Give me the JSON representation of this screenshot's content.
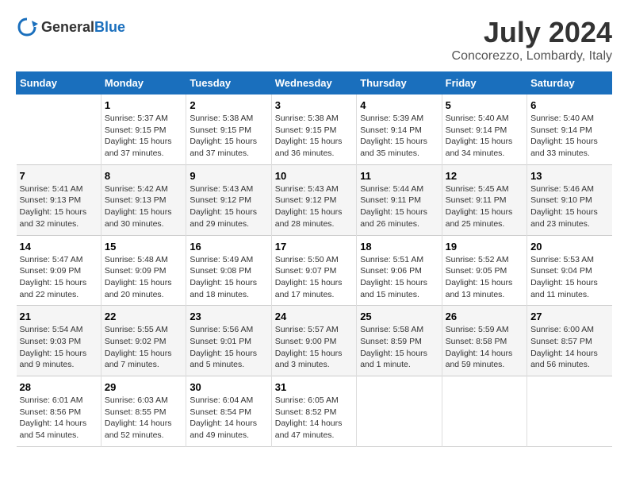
{
  "header": {
    "logo_general": "General",
    "logo_blue": "Blue",
    "title": "July 2024",
    "subtitle": "Concorezzo, Lombardy, Italy"
  },
  "calendar": {
    "days_of_week": [
      "Sunday",
      "Monday",
      "Tuesday",
      "Wednesday",
      "Thursday",
      "Friday",
      "Saturday"
    ],
    "weeks": [
      [
        {
          "day": "",
          "info": ""
        },
        {
          "day": "1",
          "info": "Sunrise: 5:37 AM\nSunset: 9:15 PM\nDaylight: 15 hours\nand 37 minutes."
        },
        {
          "day": "2",
          "info": "Sunrise: 5:38 AM\nSunset: 9:15 PM\nDaylight: 15 hours\nand 37 minutes."
        },
        {
          "day": "3",
          "info": "Sunrise: 5:38 AM\nSunset: 9:15 PM\nDaylight: 15 hours\nand 36 minutes."
        },
        {
          "day": "4",
          "info": "Sunrise: 5:39 AM\nSunset: 9:14 PM\nDaylight: 15 hours\nand 35 minutes."
        },
        {
          "day": "5",
          "info": "Sunrise: 5:40 AM\nSunset: 9:14 PM\nDaylight: 15 hours\nand 34 minutes."
        },
        {
          "day": "6",
          "info": "Sunrise: 5:40 AM\nSunset: 9:14 PM\nDaylight: 15 hours\nand 33 minutes."
        }
      ],
      [
        {
          "day": "7",
          "info": "Sunrise: 5:41 AM\nSunset: 9:13 PM\nDaylight: 15 hours\nand 32 minutes."
        },
        {
          "day": "8",
          "info": "Sunrise: 5:42 AM\nSunset: 9:13 PM\nDaylight: 15 hours\nand 30 minutes."
        },
        {
          "day": "9",
          "info": "Sunrise: 5:43 AM\nSunset: 9:12 PM\nDaylight: 15 hours\nand 29 minutes."
        },
        {
          "day": "10",
          "info": "Sunrise: 5:43 AM\nSunset: 9:12 PM\nDaylight: 15 hours\nand 28 minutes."
        },
        {
          "day": "11",
          "info": "Sunrise: 5:44 AM\nSunset: 9:11 PM\nDaylight: 15 hours\nand 26 minutes."
        },
        {
          "day": "12",
          "info": "Sunrise: 5:45 AM\nSunset: 9:11 PM\nDaylight: 15 hours\nand 25 minutes."
        },
        {
          "day": "13",
          "info": "Sunrise: 5:46 AM\nSunset: 9:10 PM\nDaylight: 15 hours\nand 23 minutes."
        }
      ],
      [
        {
          "day": "14",
          "info": "Sunrise: 5:47 AM\nSunset: 9:09 PM\nDaylight: 15 hours\nand 22 minutes."
        },
        {
          "day": "15",
          "info": "Sunrise: 5:48 AM\nSunset: 9:09 PM\nDaylight: 15 hours\nand 20 minutes."
        },
        {
          "day": "16",
          "info": "Sunrise: 5:49 AM\nSunset: 9:08 PM\nDaylight: 15 hours\nand 18 minutes."
        },
        {
          "day": "17",
          "info": "Sunrise: 5:50 AM\nSunset: 9:07 PM\nDaylight: 15 hours\nand 17 minutes."
        },
        {
          "day": "18",
          "info": "Sunrise: 5:51 AM\nSunset: 9:06 PM\nDaylight: 15 hours\nand 15 minutes."
        },
        {
          "day": "19",
          "info": "Sunrise: 5:52 AM\nSunset: 9:05 PM\nDaylight: 15 hours\nand 13 minutes."
        },
        {
          "day": "20",
          "info": "Sunrise: 5:53 AM\nSunset: 9:04 PM\nDaylight: 15 hours\nand 11 minutes."
        }
      ],
      [
        {
          "day": "21",
          "info": "Sunrise: 5:54 AM\nSunset: 9:03 PM\nDaylight: 15 hours\nand 9 minutes."
        },
        {
          "day": "22",
          "info": "Sunrise: 5:55 AM\nSunset: 9:02 PM\nDaylight: 15 hours\nand 7 minutes."
        },
        {
          "day": "23",
          "info": "Sunrise: 5:56 AM\nSunset: 9:01 PM\nDaylight: 15 hours\nand 5 minutes."
        },
        {
          "day": "24",
          "info": "Sunrise: 5:57 AM\nSunset: 9:00 PM\nDaylight: 15 hours\nand 3 minutes."
        },
        {
          "day": "25",
          "info": "Sunrise: 5:58 AM\nSunset: 8:59 PM\nDaylight: 15 hours\nand 1 minute."
        },
        {
          "day": "26",
          "info": "Sunrise: 5:59 AM\nSunset: 8:58 PM\nDaylight: 14 hours\nand 59 minutes."
        },
        {
          "day": "27",
          "info": "Sunrise: 6:00 AM\nSunset: 8:57 PM\nDaylight: 14 hours\nand 56 minutes."
        }
      ],
      [
        {
          "day": "28",
          "info": "Sunrise: 6:01 AM\nSunset: 8:56 PM\nDaylight: 14 hours\nand 54 minutes."
        },
        {
          "day": "29",
          "info": "Sunrise: 6:03 AM\nSunset: 8:55 PM\nDaylight: 14 hours\nand 52 minutes."
        },
        {
          "day": "30",
          "info": "Sunrise: 6:04 AM\nSunset: 8:54 PM\nDaylight: 14 hours\nand 49 minutes."
        },
        {
          "day": "31",
          "info": "Sunrise: 6:05 AM\nSunset: 8:52 PM\nDaylight: 14 hours\nand 47 minutes."
        },
        {
          "day": "",
          "info": ""
        },
        {
          "day": "",
          "info": ""
        },
        {
          "day": "",
          "info": ""
        }
      ]
    ]
  }
}
